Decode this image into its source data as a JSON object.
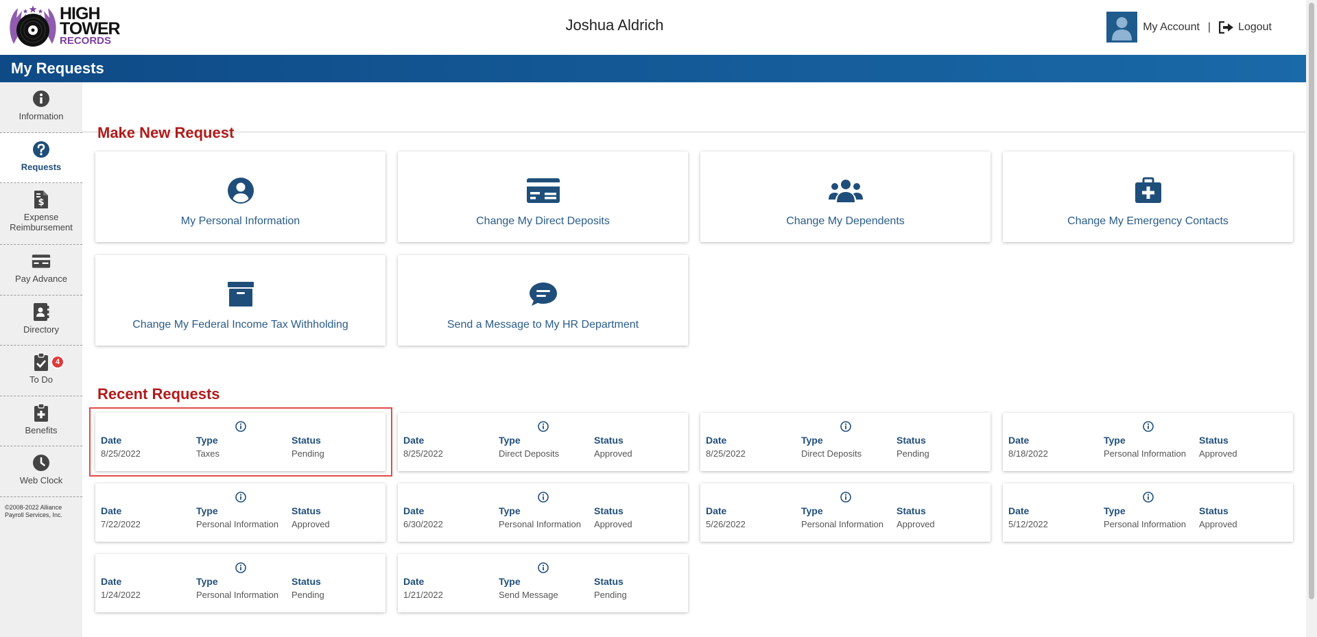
{
  "brand": {
    "line1": "HIGH",
    "line2": "TOWER",
    "line3": "RECORDS",
    "purple": "#7b3fa0"
  },
  "header": {
    "user_name": "Joshua Aldrich",
    "my_account": "My Account",
    "separator": "|",
    "logout": "Logout"
  },
  "page_title": "My Requests",
  "colors": {
    "accent_blue": "#1f4e7a",
    "title_red": "#b01c1c",
    "badge_red": "#e03a3a"
  },
  "sidebar": {
    "items": [
      {
        "label": "Information",
        "icon": "info-circle-icon"
      },
      {
        "label": "Requests",
        "icon": "question-circle-icon",
        "active": true
      },
      {
        "label": "Expense Reimbursement",
        "icon": "invoice-dollar-icon"
      },
      {
        "label": "Pay Advance",
        "icon": "money-bill-icon"
      },
      {
        "label": "Directory",
        "icon": "address-book-icon"
      },
      {
        "label": "To Do",
        "icon": "clipboard-check-icon",
        "badge": "4"
      },
      {
        "label": "Benefits",
        "icon": "medical-clipboard-icon"
      },
      {
        "label": "Web Clock",
        "icon": "clock-icon"
      }
    ],
    "copyright": "©2008-2022 Alliance Payroll Services, Inc."
  },
  "new_request": {
    "title": "Make New Request",
    "cards": [
      {
        "label": "My Personal Information",
        "icon": "user-circle-icon"
      },
      {
        "label": "Change My Direct Deposits",
        "icon": "bank-card-icon"
      },
      {
        "label": "Change My Dependents",
        "icon": "users-icon"
      },
      {
        "label": "Change My Emergency Contacts",
        "icon": "first-aid-kit-icon"
      },
      {
        "label": "Change My Federal Income Tax Withholding",
        "icon": "archive-box-icon"
      },
      {
        "label": "Send a Message to My HR Department",
        "icon": "chat-bubble-icon"
      }
    ]
  },
  "recent_requests": {
    "title": "Recent Requests",
    "headers": {
      "date": "Date",
      "type": "Type",
      "status": "Status"
    },
    "items": [
      {
        "date": "8/25/2022",
        "type": "Taxes",
        "status": "Pending"
      },
      {
        "date": "8/25/2022",
        "type": "Direct Deposits",
        "status": "Approved"
      },
      {
        "date": "8/25/2022",
        "type": "Direct Deposits",
        "status": "Pending"
      },
      {
        "date": "8/18/2022",
        "type": "Personal Information",
        "status": "Approved"
      },
      {
        "date": "7/22/2022",
        "type": "Personal Information",
        "status": "Approved"
      },
      {
        "date": "6/30/2022",
        "type": "Personal Information",
        "status": "Approved"
      },
      {
        "date": "5/26/2022",
        "type": "Personal Information",
        "status": "Approved"
      },
      {
        "date": "5/12/2022",
        "type": "Personal Information",
        "status": "Approved"
      },
      {
        "date": "1/24/2022",
        "type": "Personal Information",
        "status": "Pending"
      },
      {
        "date": "1/21/2022",
        "type": "Send Message",
        "status": "Pending"
      }
    ]
  }
}
